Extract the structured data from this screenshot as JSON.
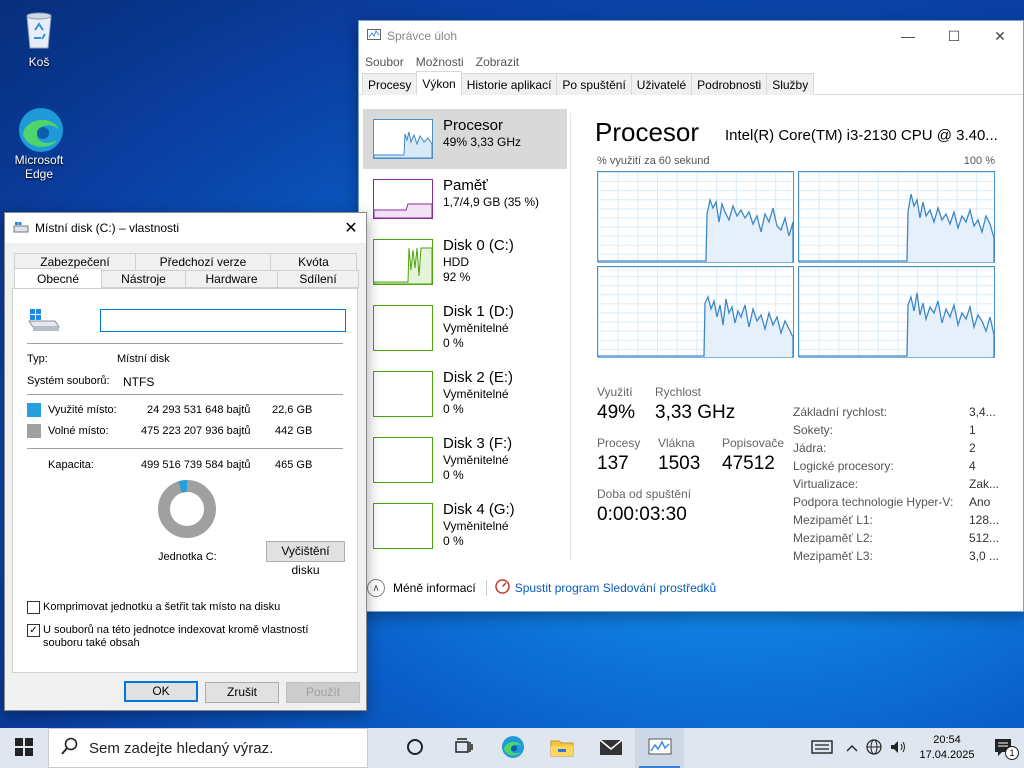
{
  "desktop": {
    "icons": [
      {
        "label": "Koš",
        "icon": "recycle-bin-icon"
      },
      {
        "label": "Microsoft Edge",
        "icon": "edge-icon"
      }
    ]
  },
  "task_manager": {
    "title": "Správce úloh",
    "menu": [
      "Soubor",
      "Možnosti",
      "Zobrazit"
    ],
    "tabs": [
      "Procesy",
      "Výkon",
      "Historie aplikací",
      "Po spuštění",
      "Uživatelé",
      "Podrobnosti",
      "Služby"
    ],
    "active_tab": "Výkon",
    "side": [
      {
        "name": "Procesor",
        "sub1": "49% 3,33 GHz",
        "sub2": ""
      },
      {
        "name": "Paměť",
        "sub1": "1,7/4,9 GB (35 %)",
        "sub2": ""
      },
      {
        "name": "Disk 0 (C:)",
        "sub1": "HDD",
        "sub2": "92 %"
      },
      {
        "name": "Disk 1 (D:)",
        "sub1": "Vyměnitelné",
        "sub2": "0 %"
      },
      {
        "name": "Disk 2 (E:)",
        "sub1": "Vyměnitelné",
        "sub2": "0 %"
      },
      {
        "name": "Disk 3 (F:)",
        "sub1": "Vyměnitelné",
        "sub2": "0 %"
      },
      {
        "name": "Disk 4 (G:)",
        "sub1": "Vyměnitelné",
        "sub2": "0 %"
      }
    ],
    "main": {
      "title": "Procesor",
      "cpu_name": "Intel(R) Core(TM) i3-2130 CPU @ 3.40...",
      "graph_label": "% využití za 60 sekund",
      "graph_max": "100 %",
      "stats": {
        "util_label": "Využití",
        "util_value": "49%",
        "speed_label": "Rychlost",
        "speed_value": "3,33 GHz",
        "proc_label": "Procesy",
        "proc_value": "137",
        "threads_label": "Vlákna",
        "threads_value": "1503",
        "handles_label": "Popisovače",
        "handles_value": "47512",
        "uptime_label": "Doba od spuštění",
        "uptime_value": "0:00:03:30"
      },
      "specs": [
        {
          "k": "Základní rychlost:",
          "v": "3,4..."
        },
        {
          "k": "Sokety:",
          "v": "1"
        },
        {
          "k": "Jádra:",
          "v": "2"
        },
        {
          "k": "Logické procesory:",
          "v": "4"
        },
        {
          "k": "Virtualizace:",
          "v": "Zak..."
        },
        {
          "k": "Podpora technologie Hyper-V:",
          "v": "Ano"
        },
        {
          "k": "Mezipaměť L1:",
          "v": "128..."
        },
        {
          "k": "Mezipaměť L2:",
          "v": "512..."
        },
        {
          "k": "Mezipaměť L3:",
          "v": "3,0 ..."
        }
      ]
    },
    "footer": {
      "less_info": "Méně informací",
      "monitor_link": "Spustit program Sledování prostředků"
    }
  },
  "properties": {
    "title": "Místní disk (C:) – vlastnosti",
    "tabs_row1": [
      "Zabezpečení",
      "Předchozí verze",
      "Kvóta"
    ],
    "tabs_row2": [
      "Obecné",
      "Nástroje",
      "Hardware",
      "Sdílení"
    ],
    "active_tab": "Obecné",
    "name_value": "",
    "type_label": "Typ:",
    "type_value": "Místní disk",
    "fs_label": "Systém souborů:",
    "fs_value": "NTFS",
    "used_label": "Využité místo:",
    "used_bytes": "24 293 531 648 bajtů",
    "used_gb": "22,6 GB",
    "free_label": "Volné místo:",
    "free_bytes": "475 223 207 936 bajtů",
    "free_gb": "442 GB",
    "cap_label": "Kapacita:",
    "cap_bytes": "499 516 739 584 bajtů",
    "cap_gb": "465 GB",
    "drive_label": "Jednotka C:",
    "cleanup_button": "Vyčištění disku",
    "compress_label": "Komprimovat jednotku a šetřit tak místo na disku",
    "compress_checked": false,
    "index_label": "U souborů na této jednotce indexovat kromě vlastností souboru také obsah",
    "index_checked": true,
    "ok": "OK",
    "cancel": "Zrušit",
    "apply": "Použít",
    "used_color": "#26a0da",
    "free_color": "#a0a0a0"
  },
  "taskbar": {
    "search_placeholder": "Sem zadejte hledaný výraz.",
    "time": "20:54",
    "date": "17.04.2025",
    "notifications": "1"
  }
}
